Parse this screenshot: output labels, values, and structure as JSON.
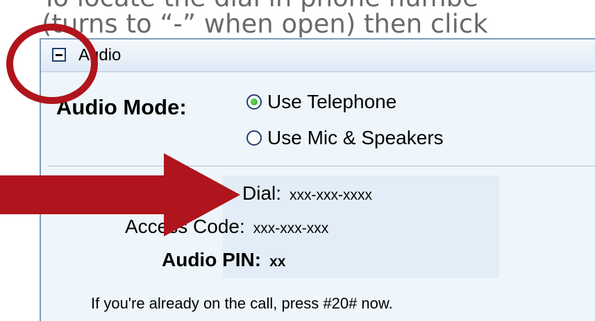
{
  "caption": {
    "line1": "To locate the dial in phone numbe",
    "line2": "(turns to “-” when open) then click"
  },
  "audio_panel": {
    "title": "Audio",
    "toggle_icon": "minus-icon",
    "mode_label": "Audio Mode:",
    "options": [
      {
        "label": "Use Telephone",
        "selected": true
      },
      {
        "label": "Use Mic & Speakers",
        "selected": false
      }
    ],
    "dial_label": "Dial:",
    "dial_value": "xxx-xxx-xxxx",
    "access_label": "Access Code:",
    "access_value": "xxx-xxx-xxx",
    "pin_label": "Audio PIN:",
    "pin_value": "xx",
    "note": "If you're already on the call, press #20# now."
  },
  "annotations": {
    "color": "#b0141c",
    "shapes": [
      "circle-annotation",
      "arrow-annotation"
    ]
  }
}
